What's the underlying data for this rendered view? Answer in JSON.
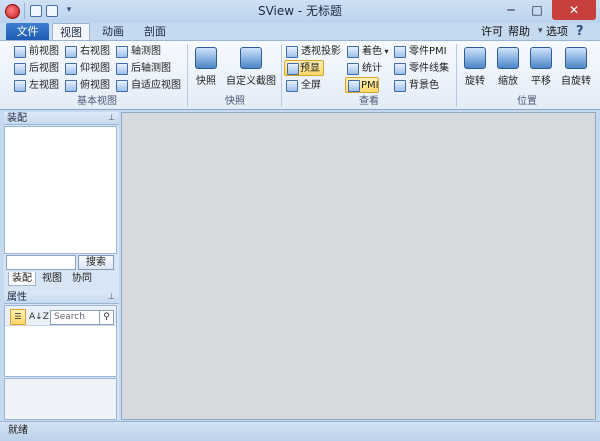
{
  "window": {
    "title": "SView - 无标题",
    "controls": {
      "min": "─",
      "max": "□",
      "close": "✕"
    }
  },
  "quick_access": {
    "more": "▾"
  },
  "tabs": {
    "file": "文件",
    "view": "视图",
    "animation": "动画",
    "section": "剖面"
  },
  "right_links": {
    "license": "许可",
    "help": "帮助",
    "options": "选项",
    "help_icon": "?"
  },
  "groups": {
    "basic_views": {
      "label": "基本视图",
      "buttons": [
        "前视图",
        "右视图",
        "轴测图",
        "后视图",
        "仰视图",
        "后轴测图",
        "左视图",
        "俯视图",
        "自适应视图"
      ]
    },
    "snapshot": {
      "label": "快照",
      "buttons": [
        "快照",
        "自定义截图"
      ]
    },
    "view": {
      "label": "查看",
      "buttons": [
        "透视投影",
        "着色",
        "零件PMI",
        "预显",
        "统计",
        "零件线集",
        "全屏",
        "PMI",
        "背景色"
      ]
    },
    "position": {
      "label": "位置",
      "buttons": [
        "旋转",
        "缩放",
        "平移",
        "自旋转"
      ]
    }
  },
  "assembly_panel": {
    "title": "装配",
    "search_button": "搜索",
    "tabs": [
      "装配",
      "视图",
      "协同"
    ]
  },
  "properties_panel": {
    "title": "属性",
    "search_placeholder": "Search",
    "sort_icon": "A↓Z"
  },
  "status": {
    "text": "就绪"
  }
}
